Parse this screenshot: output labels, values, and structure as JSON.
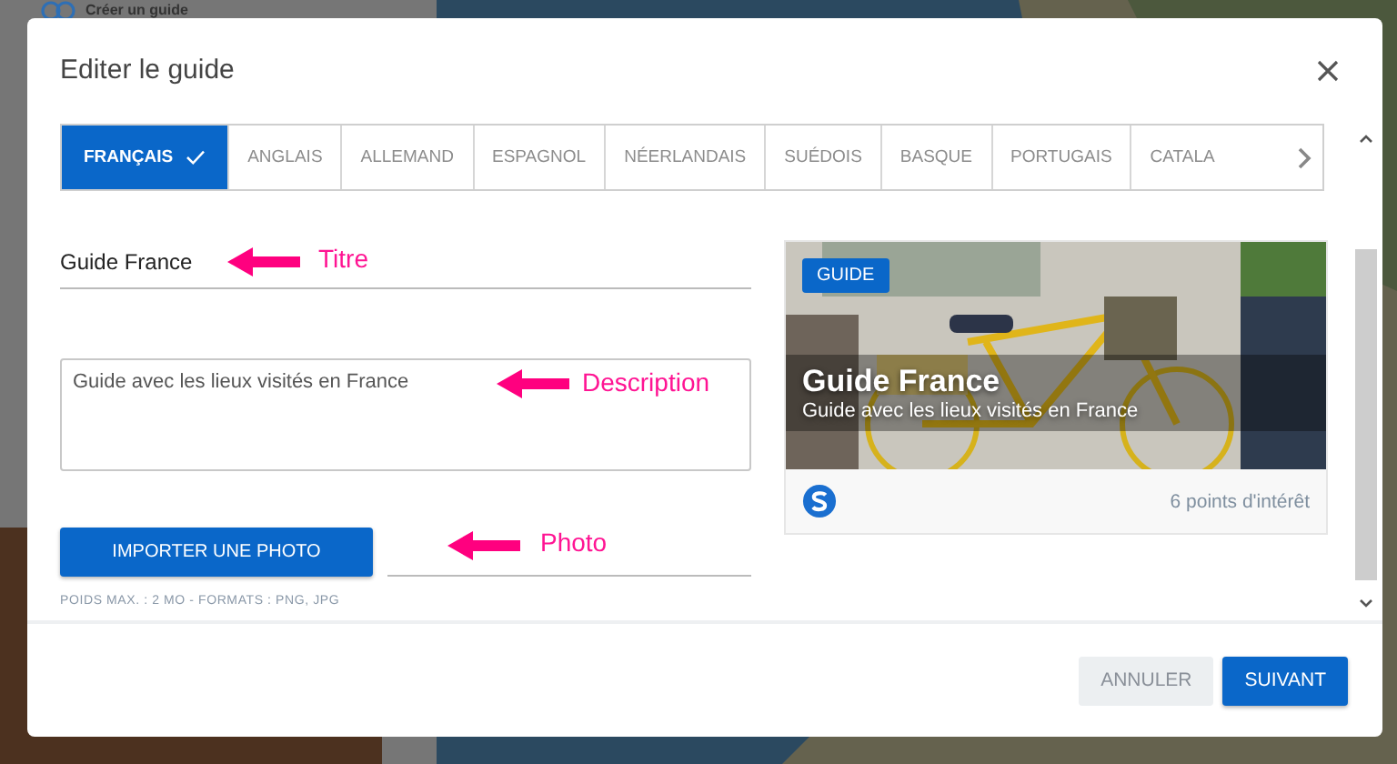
{
  "background": {
    "link": "Créer un guide"
  },
  "dialog": {
    "title": "Editer le guide"
  },
  "tabs": [
    {
      "label": "FRANÇAIS",
      "selected": true
    },
    {
      "label": "ANGLAIS",
      "selected": false
    },
    {
      "label": "ALLEMAND",
      "selected": false
    },
    {
      "label": "ESPAGNOL",
      "selected": false
    },
    {
      "label": "NÉERLANDAIS",
      "selected": false
    },
    {
      "label": "SUÉDOIS",
      "selected": false
    },
    {
      "label": "BASQUE",
      "selected": false
    },
    {
      "label": "PORTUGAIS",
      "selected": false
    },
    {
      "label": "CATALA",
      "selected": false
    }
  ],
  "form": {
    "title_value": "Guide France",
    "description_value": "Guide avec les lieux visités en France",
    "upload_button": "IMPORTER UNE PHOTO",
    "upload_hint": "POIDS MAX. : 2 MO - FORMATS : PNG, JPG"
  },
  "annotations": [
    {
      "label": "Titre"
    },
    {
      "label": "Description"
    },
    {
      "label": "Photo"
    }
  ],
  "preview": {
    "badge": "GUIDE",
    "title": "Guide France",
    "subtitle": "Guide avec les lieux visités en France",
    "points": "6 points d'intérêt"
  },
  "buttons": [
    {
      "label": "ANNULER",
      "kind": "secondary"
    },
    {
      "label": "SUIVANT",
      "kind": "primary"
    }
  ]
}
